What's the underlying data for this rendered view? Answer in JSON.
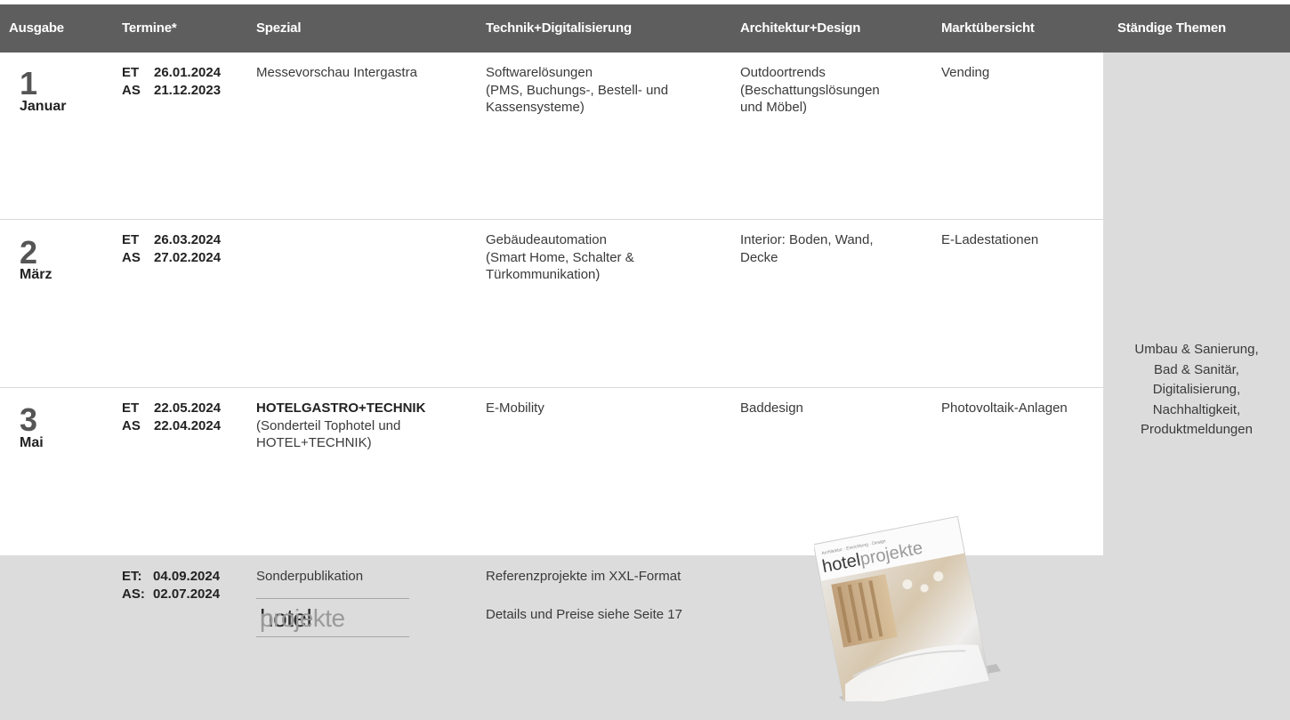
{
  "header": {
    "col_ausgabe": "Ausgabe",
    "col_termine": "Termine*",
    "col_spezial": "Spezial",
    "col_technik": "Technik+Digitalisierung",
    "col_architektur": "Architektur+Design",
    "col_markt": "Marktübersicht",
    "col_themen": "Ständige Themen"
  },
  "issues": [
    {
      "number": "1",
      "month": "Januar",
      "et_label": "ET",
      "et": "26.01.2024",
      "as_label": "AS",
      "as": "21.12.2023",
      "spezial": "Messevorschau Intergastra",
      "technik": [
        "Softwarelösungen",
        "(PMS, Buchungs-, Bestell- und",
        "Kassensysteme)"
      ],
      "architektur": [
        "Outdoortrends",
        "(Beschattungslösungen",
        "und Möbel)"
      ],
      "markt": "Vending"
    },
    {
      "number": "2",
      "month": "März",
      "et_label": "ET",
      "et": "26.03.2024",
      "as_label": "AS",
      "as": "27.02.2024",
      "technik": [
        "Gebäudeautomation",
        "(Smart Home, Schalter &",
        "Türkommunikation)"
      ],
      "architektur": [
        "Interior: Boden, Wand,",
        "Decke"
      ],
      "markt": "E-Ladestationen"
    },
    {
      "number": "3",
      "month": "Mai",
      "et_label": "ET",
      "et": "22.05.2024",
      "as_label": "AS",
      "as": "22.04.2024",
      "spezial_bold": "HOTELGASTRO+TECHNIK",
      "spezial": [
        "(Sonderteil Tophotel und",
        "HOTEL+TECHNIK)"
      ],
      "technik": "E-Mobility",
      "architektur": "Baddesign",
      "markt": "Photovoltaik-Anlagen"
    }
  ],
  "special": {
    "et_label": "ET:",
    "et": "04.09.2024",
    "as_label": "AS:",
    "as": "02.07.2024",
    "title": "Sonderpublikation",
    "logo_part1": "hotel",
    "logo_part2": "projekte",
    "line1": "Referenzprojekte im XXL-Format",
    "line2": "Details und Preise siehe Seite 17"
  },
  "magazine": {
    "tagline": "Architektur · Einrichtung · Design",
    "logo_part1": "hotel",
    "logo_part2": "projekte"
  },
  "staendige_themen": [
    "Umbau & Sanierung,",
    "Bad & Sanitär,",
    "Digitalisierung,",
    "Nachhaltigkeit,",
    "Produktmeldungen"
  ]
}
